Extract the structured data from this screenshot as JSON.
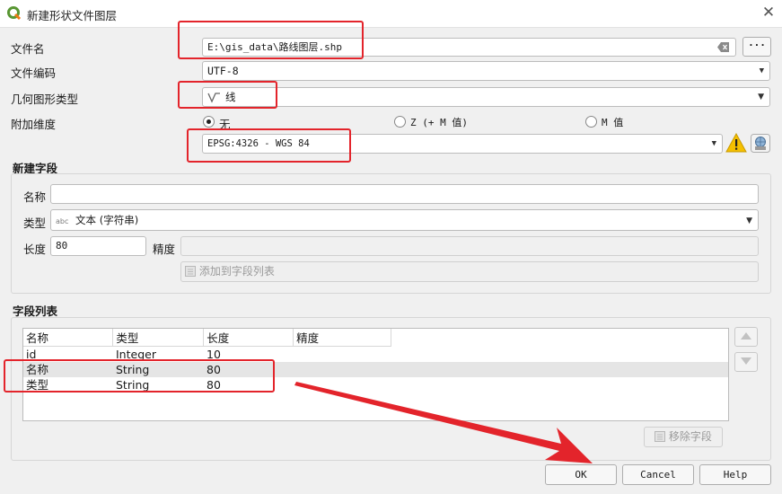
{
  "window": {
    "title": "新建形状文件图层",
    "close_glyph": "✕"
  },
  "form": {
    "filename_label": "文件名",
    "filename_value": "E:\\gis_data\\路线图层.shp",
    "browse_label": "···",
    "encoding_label": "文件编码",
    "encoding_value": "UTF-8",
    "geometry_label": "几何图形类型",
    "geometry_value": "线",
    "dimension_label": "附加维度",
    "dim_none": "无",
    "dim_z": "Z (+ M 值)",
    "dim_m": "M 值",
    "crs_value": "EPSG:4326 - WGS 84"
  },
  "new_field": {
    "title": "新建字段",
    "name_label": "名称",
    "name_value": "",
    "type_label": "类型",
    "type_prefix": "abc",
    "type_value": "文本 (字符串)",
    "length_label": "长度",
    "length_value": "80",
    "precision_label": "精度",
    "precision_value": "",
    "add_button": "添加到字段列表"
  },
  "field_list": {
    "title": "字段列表",
    "columns": [
      "名称",
      "类型",
      "长度",
      "精度"
    ],
    "rows": [
      [
        "id",
        "Integer",
        "10",
        ""
      ],
      [
        "名称",
        "String",
        "80",
        ""
      ],
      [
        "类型",
        "String",
        "80",
        ""
      ]
    ],
    "remove_button": "移除字段"
  },
  "buttons": {
    "ok": "OK",
    "cancel": "Cancel",
    "help": "Help"
  },
  "colors": {
    "annotation_red": "#e3242b",
    "warning_yellow": "#f5c000"
  }
}
